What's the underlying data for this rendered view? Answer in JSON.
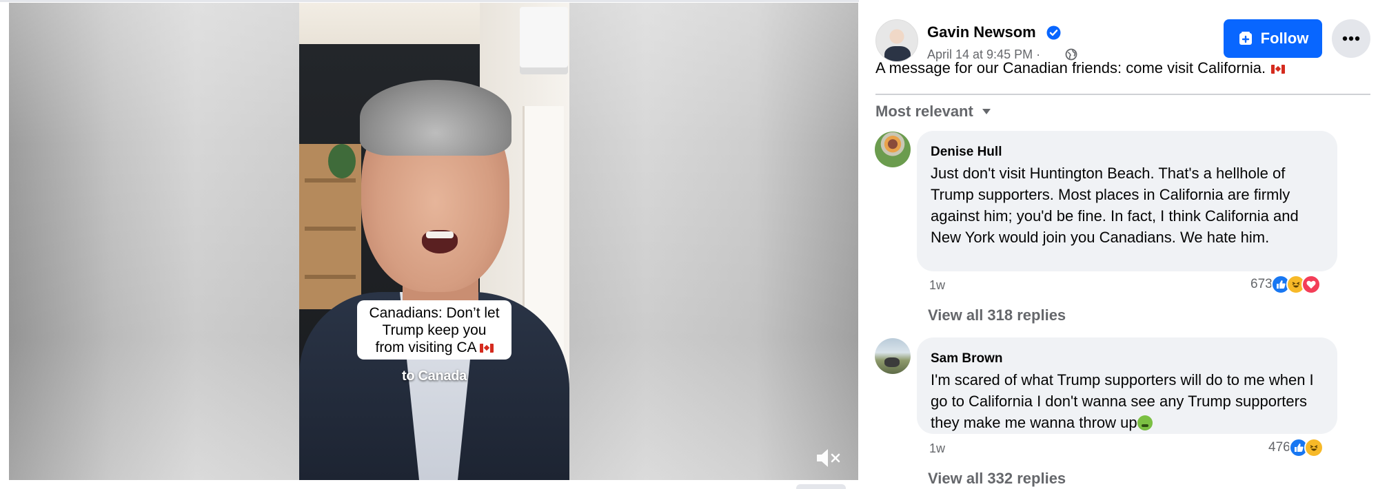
{
  "video": {
    "caption_lines": [
      "Canadians: Don’t let",
      "Trump keep you",
      "from visiting CA"
    ],
    "sub_caption": "to Canada",
    "mute_icon": "volume-muted-icon"
  },
  "post": {
    "author": "Gavin Newsom",
    "verified": true,
    "date": "April 14 at 9:45 PM ·",
    "audience_icon": "globe-icon",
    "text": "A message for our Canadian friends: come visit California.",
    "follow_label": "Follow",
    "more_icon": "more-horizontal-icon"
  },
  "comments_sort": {
    "label": "Most relevant"
  },
  "comments": [
    {
      "author": "Denise Hull",
      "text": "Just don't visit Huntington Beach. That's a hellhole of Trump supporters. Most places in California are firmly against him; you'd be fine. In fact, I think California and New York would join you Canadians. We hate him.",
      "time": "1w",
      "reaction_count": "673",
      "reactions": [
        "like",
        "haha",
        "love"
      ],
      "view_replies": "View all 318 replies"
    },
    {
      "author": "Sam Brown",
      "text": "I'm scared of what Trump supporters will do to me when I go to California I don't wanna see any Trump supporters they make me wanna throw up",
      "time": "1w",
      "reaction_count": "476",
      "reactions": [
        "like",
        "haha"
      ],
      "view_replies": "View all 332 replies"
    }
  ],
  "colors": {
    "accent": "#0866ff",
    "secondary_text": "#65676b",
    "bubble_bg": "#f0f2f5",
    "like": "#1877f2",
    "haha": "#f7b928",
    "love": "#f33e58"
  }
}
